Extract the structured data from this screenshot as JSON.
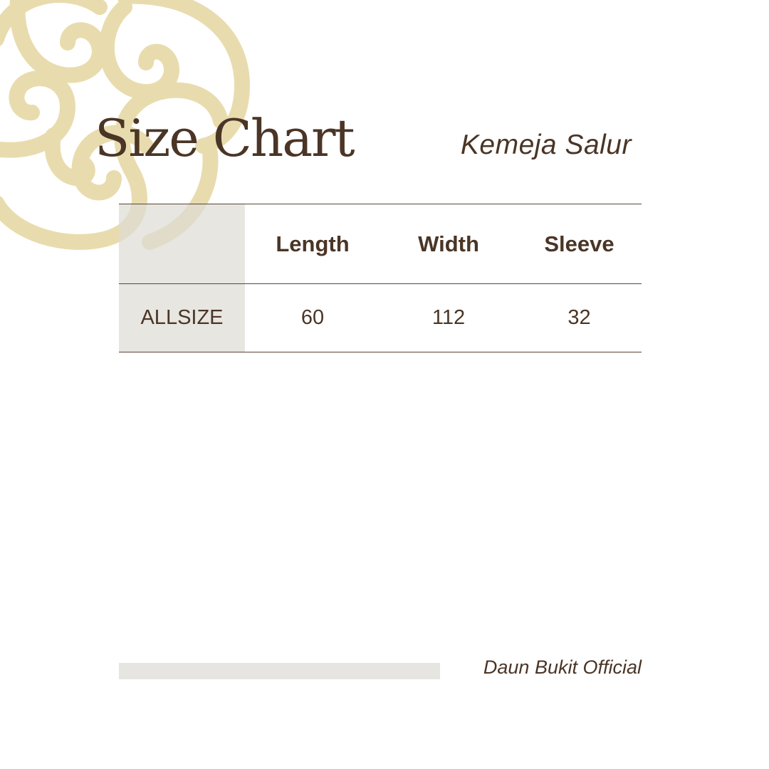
{
  "header": {
    "title": "Size Chart",
    "subtitle": "Kemeja Salur"
  },
  "size_table": {
    "columns": [
      "",
      "Length",
      "Width",
      "Sleeve"
    ],
    "rows": [
      {
        "size": "ALLSIZE",
        "length": "60",
        "width": "112",
        "sleeve": "32"
      }
    ]
  },
  "footer": {
    "brand": "Daun Bukit Official"
  },
  "colors": {
    "text": "#4a3526",
    "ornament": "#e8dcae",
    "grey_fill": "#e6e5e2",
    "background": "#ffffff"
  },
  "icons": {
    "ornament": "decorative-swirl-ornament"
  }
}
